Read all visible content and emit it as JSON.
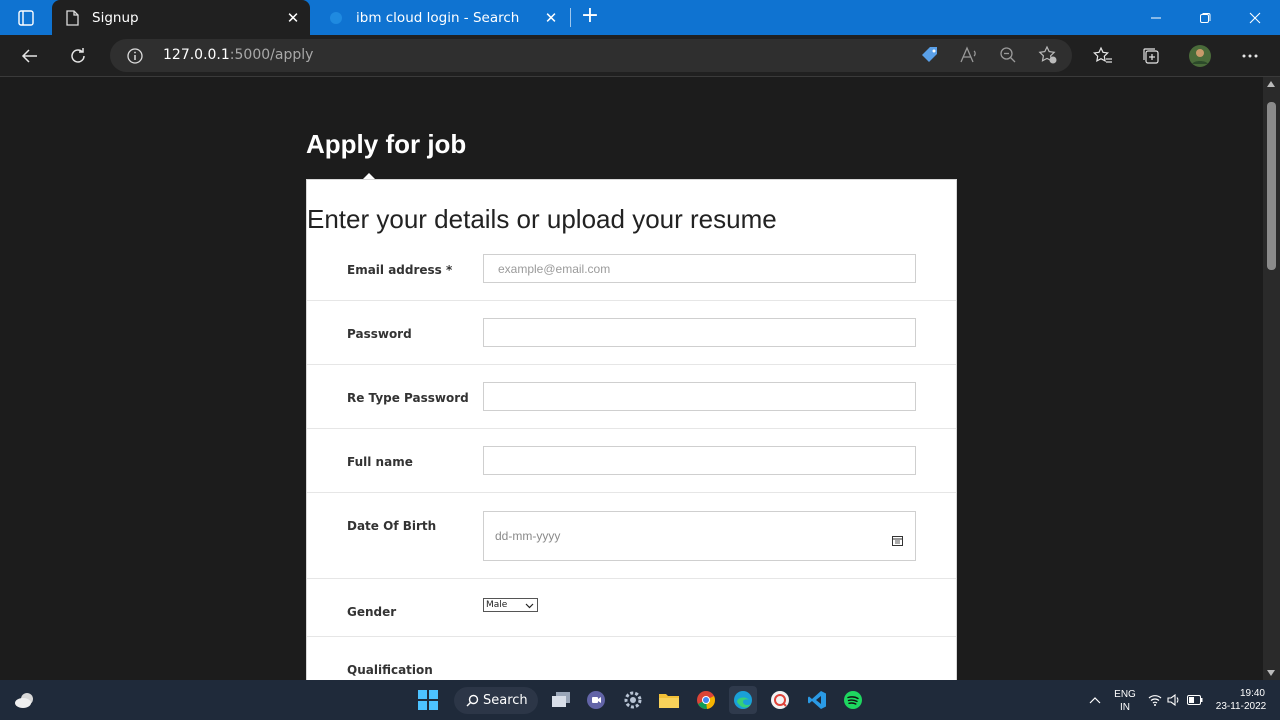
{
  "browser": {
    "tabs": [
      {
        "title": "Signup",
        "active": true
      },
      {
        "title": "ibm cloud login - Search",
        "active": false
      }
    ],
    "url_host": "127.0.0.1",
    "url_path": ":5000/apply"
  },
  "page": {
    "heading": "Apply for job",
    "form_title": "Enter your details or upload your resume",
    "fields": {
      "email_label": "Email address *",
      "email_placeholder": "example@email.com",
      "password_label": "Password",
      "retype_label": "Re Type Password",
      "fullname_label": "Full name",
      "dob_label": "Date Of Birth",
      "dob_placeholder": "dd-mm-yyyy",
      "gender_label": "Gender",
      "gender_value": "Male",
      "qualification_label": "Qualification"
    }
  },
  "taskbar": {
    "search_label": "Search",
    "lang_line1": "ENG",
    "lang_line2": "IN",
    "time": "19:40",
    "date": "23-11-2022"
  },
  "colors": {
    "titlebar": "#0f73d1",
    "page_bg": "#1c1c1c",
    "taskbar": "#1f2a3a"
  }
}
